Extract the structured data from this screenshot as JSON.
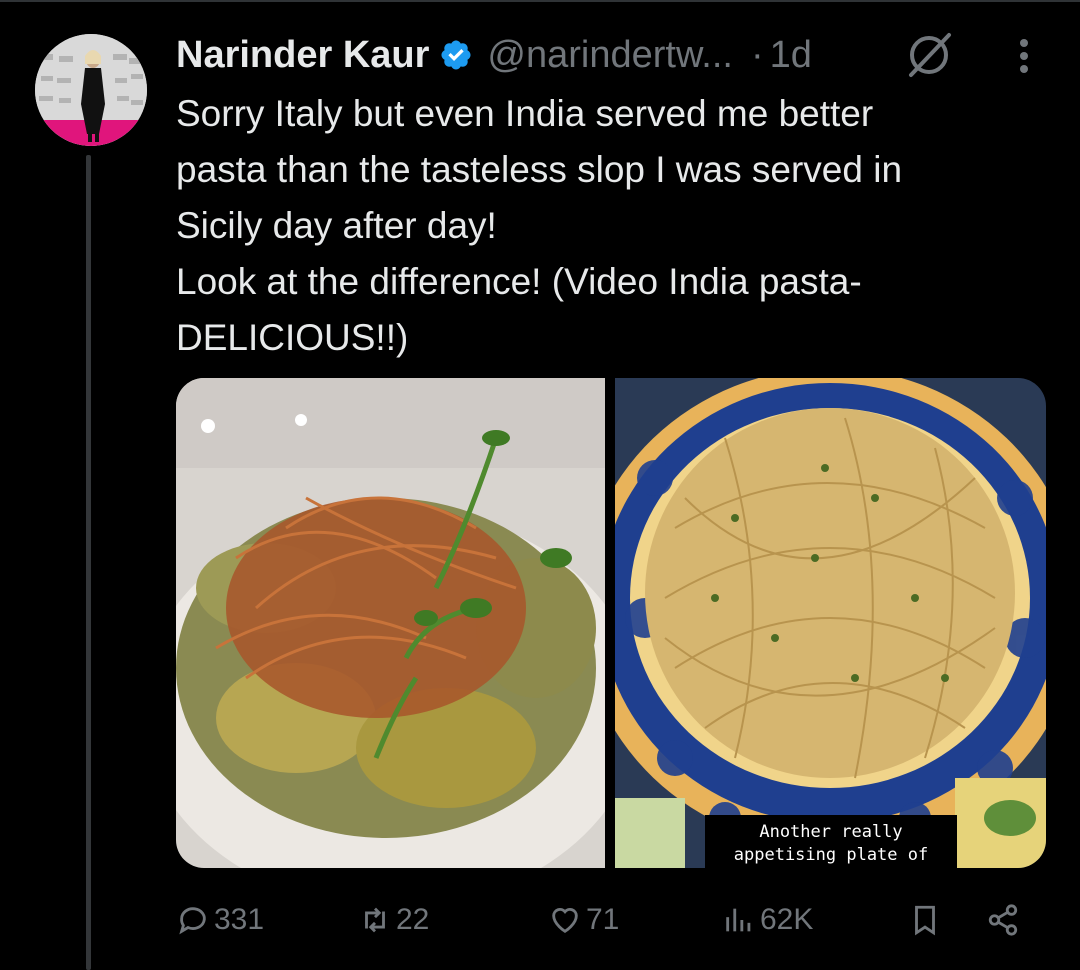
{
  "tweet": {
    "author_name": "Narinder Kaur",
    "handle": "@narindertw...",
    "separator": "·",
    "time": "1d",
    "text_lines": [
      "Sorry Italy but even India served me better",
      "pasta than the tasteless slop I was served in",
      "Sicily day after day!",
      "Look at the difference! (Video India pasta-",
      "DELICIOUS!!)"
    ],
    "media": {
      "right_caption_lines": [
        "Another really",
        "appetising plate of"
      ]
    }
  },
  "actions": {
    "replies": "331",
    "reposts": "22",
    "likes": "71",
    "views": "62K"
  },
  "colors": {
    "background": "#000000",
    "text": "#e7e9ea",
    "muted": "#71767b",
    "verified": "#1d9bf0",
    "divider": "#2f3336"
  },
  "icons": [
    "verified-badge-icon",
    "grok-icon",
    "more-icon",
    "reply-icon",
    "repost-icon",
    "like-icon",
    "views-icon",
    "bookmark-icon",
    "share-icon"
  ]
}
